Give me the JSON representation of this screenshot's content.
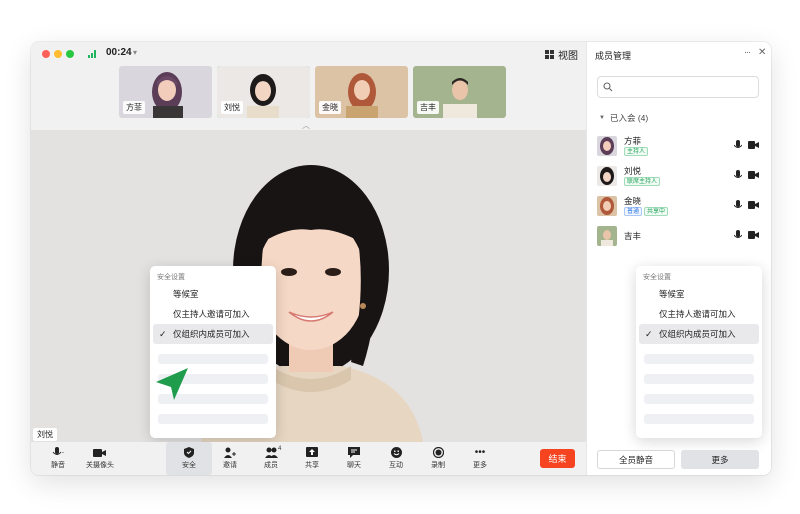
{
  "titlebar": {
    "timer": "00:24",
    "view_label": "视图"
  },
  "thumbnails": [
    {
      "name": "方菲",
      "active": false
    },
    {
      "name": "刘悦",
      "active": true
    },
    {
      "name": "金晓",
      "active": false
    },
    {
      "name": "吉丰",
      "active": false
    }
  ],
  "stage": {
    "speaker_name": "刘悦"
  },
  "toolbar": {
    "mute_label": "静音",
    "camera_label": "关摄像头",
    "security_label": "安全",
    "invite_label": "邀请",
    "members_label": "成员",
    "members_count": "4",
    "share_label": "共享",
    "chat_label": "聊天",
    "interact_label": "互动",
    "record_label": "录制",
    "more_label": "更多",
    "end_label": "结束",
    "end_color": "#f5441f"
  },
  "security_menu": {
    "title": "安全设置",
    "items": [
      "等候室",
      "仅主持人邀请可加入",
      "仅组织内成员可加入"
    ],
    "selected_item": "仅组织内成员可加入"
  },
  "panel": {
    "title": "成员管理",
    "search_placeholder": "",
    "section_label": "已入会 (4)",
    "members": [
      {
        "name": "方菲",
        "tags": [
          {
            "text": "主持人",
            "color": "green"
          }
        ]
      },
      {
        "name": "刘悦",
        "tags": [
          {
            "text": "联席主持人",
            "color": "green"
          }
        ]
      },
      {
        "name": "金晓",
        "tags": [
          {
            "text": "普通",
            "color": "blue"
          },
          {
            "text": "共享中",
            "color": "green"
          }
        ]
      },
      {
        "name": "吉丰",
        "tags": []
      }
    ],
    "mute_all_label": "全员静音",
    "more_label": "更多"
  },
  "accent_color": "#22b35e"
}
